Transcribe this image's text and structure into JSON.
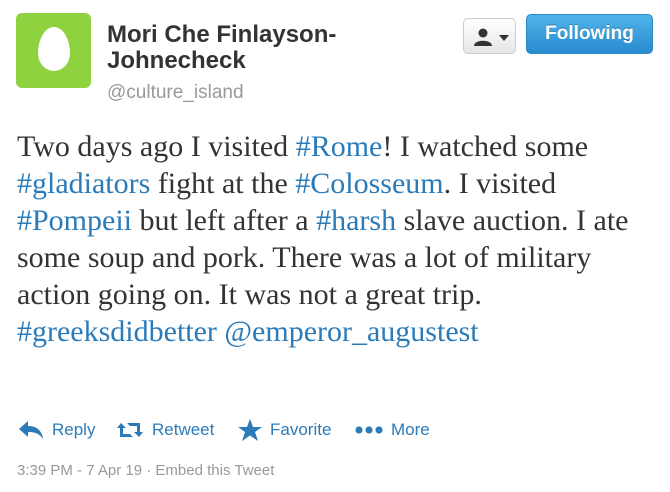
{
  "user": {
    "name": "Mori Che Finlayson-Johnecheck",
    "handle": "@culture_island",
    "avatar": "default-egg-avatar",
    "avatar_color": "#8ed33f"
  },
  "buttons": {
    "user_menu_icon": "user-dropdown-icon",
    "follow_label": "Following",
    "follow_color": "#2b8ed3"
  },
  "tweet": {
    "segments": [
      {
        "text": "Two days ago I visited ",
        "type": "text"
      },
      {
        "text": "#Rome",
        "type": "hashtag"
      },
      {
        "text": "! I watched some ",
        "type": "text"
      },
      {
        "text": "#gladiators",
        "type": "hashtag"
      },
      {
        "text": " fight at the ",
        "type": "text"
      },
      {
        "text": "#Colosseum",
        "type": "hashtag"
      },
      {
        "text": ". I visited ",
        "type": "text"
      },
      {
        "text": "#Pompeii",
        "type": "hashtag"
      },
      {
        "text": " but left after a ",
        "type": "text"
      },
      {
        "text": "#harsh",
        "type": "hashtag"
      },
      {
        "text": " slave auction. I ate some soup and pork. There was a lot of military action going on. It was not a great trip. ",
        "type": "text"
      },
      {
        "text": "#greeksdidbetter",
        "type": "hashtag"
      },
      {
        "text": " ",
        "type": "text"
      },
      {
        "text": "@emperor_augustest",
        "type": "mention"
      }
    ],
    "link_color": "#2b7bb9"
  },
  "actions": {
    "reply": "Reply",
    "retweet": "Retweet",
    "favorite": "Favorite",
    "more": "More"
  },
  "meta": {
    "timestamp": "3:39 PM - 7 Apr 19",
    "separator": "·",
    "embed": "Embed this Tweet"
  }
}
